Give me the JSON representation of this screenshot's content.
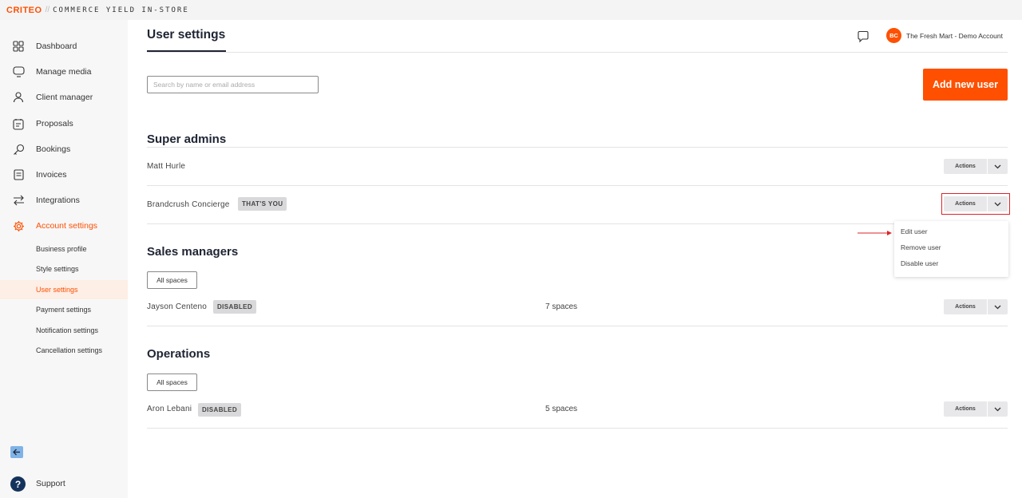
{
  "brand": {
    "logo": "CRITEO",
    "separator": "//",
    "product": "COMMERCE YIELD IN-STORE"
  },
  "sidebar": {
    "items": [
      {
        "label": "Dashboard",
        "icon": "grid-icon"
      },
      {
        "label": "Manage media",
        "icon": "monitor-icon"
      },
      {
        "label": "Client manager",
        "icon": "person-icon"
      },
      {
        "label": "Proposals",
        "icon": "proposal-icon"
      },
      {
        "label": "Bookings",
        "icon": "key-icon"
      },
      {
        "label": "Invoices",
        "icon": "invoice-icon"
      },
      {
        "label": "Integrations",
        "icon": "arrows-icon"
      },
      {
        "label": "Account settings",
        "icon": "gear-icon",
        "active": true
      }
    ],
    "subitems": [
      {
        "label": "Business profile"
      },
      {
        "label": "Style settings"
      },
      {
        "label": "User settings",
        "active": true
      },
      {
        "label": "Payment settings"
      },
      {
        "label": "Notification settings"
      },
      {
        "label": "Cancellation settings"
      }
    ],
    "support": {
      "label": "Support",
      "glyph": "?"
    }
  },
  "header": {
    "title": "User settings",
    "avatar_initials": "BC",
    "account_name": "The Fresh Mart - Demo Account"
  },
  "search": {
    "placeholder": "Search by name or email address",
    "value": ""
  },
  "add_user_label": "Add new user",
  "actions_label": "Actions",
  "super_admins": {
    "title": "Super admins",
    "users": [
      {
        "name": "Matt Hurle"
      },
      {
        "name": "Brandcrush Concierge",
        "badge": "THAT'S YOU"
      }
    ]
  },
  "sales_managers": {
    "title": "Sales managers",
    "filter_label": "All spaces",
    "users": [
      {
        "name": "Jayson Centeno",
        "badge": "DISABLED",
        "spaces": "7 spaces"
      }
    ]
  },
  "operations": {
    "title": "Operations",
    "filter_label": "All spaces",
    "users": [
      {
        "name": "Aron Lebani",
        "badge": "DISABLED",
        "spaces": "5 spaces"
      }
    ]
  },
  "actions_menu": {
    "items": [
      "Edit user",
      "Remove user",
      "Disable user"
    ]
  },
  "colors": {
    "accent": "#fe5000",
    "highlight": "#d9262c",
    "navy": "#15325c"
  }
}
